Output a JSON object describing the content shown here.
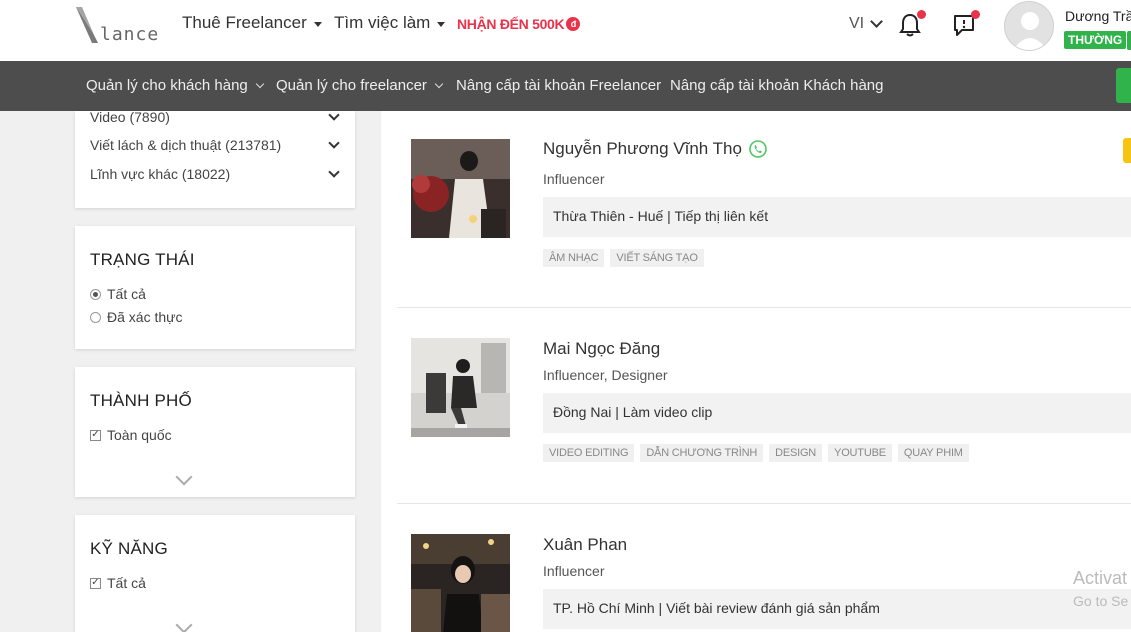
{
  "header": {
    "logo_text": "lance",
    "nav": [
      {
        "label": "Thuê Freelancer"
      },
      {
        "label": "Tìm việc làm"
      }
    ],
    "promo": "NHẬN ĐẾN 500K",
    "promo_badge": "đ",
    "lang": "VI",
    "user": {
      "name": "Dương Trầ",
      "level": "THƯỜNG"
    },
    "colors": {
      "promo": "#e8334a",
      "level": "#2fb34a",
      "notification_dot": "#e8334a"
    }
  },
  "subnav": {
    "items": [
      {
        "label": "Quản lý cho khách hàng"
      },
      {
        "label": "Quản lý cho freelancer"
      },
      {
        "label": "Nâng cấp tài khoản Freelancer"
      },
      {
        "label": "Nâng cấp tài khoản Khách hàng"
      }
    ]
  },
  "sidebar": {
    "categories": [
      {
        "label": "Video (7890)"
      },
      {
        "label": "Viết lách & dịch thuật (213781)"
      },
      {
        "label": "Lĩnh vực khác (18022)"
      }
    ],
    "status": {
      "title": "TRẠNG THÁI",
      "options": [
        {
          "label": "Tất cả",
          "selected": true
        },
        {
          "label": "Đã xác thực",
          "selected": false
        }
      ]
    },
    "city": {
      "title": "THÀNH PHỐ",
      "options": [
        {
          "label": "Toàn quốc",
          "checked": true
        }
      ]
    },
    "skills": {
      "title": "KỸ NĂNG",
      "options": [
        {
          "label": "Tất cả",
          "checked": true
        }
      ]
    }
  },
  "freelancers": [
    {
      "name": "Nguyễn Phương Vĩnh Thọ",
      "verified_icon": "whatsapp-icon",
      "role": "Influencer",
      "info": "Thừa Thiên - Huế | Tiếp thị liên kết",
      "tags": [
        "ÂM NHẠC",
        "VIẾT SÁNG TẠO"
      ]
    },
    {
      "name": "Mai Ngọc Đăng",
      "role": "Influencer, Designer",
      "info": "Đồng Nai | Làm video clip",
      "tags": [
        "VIDEO EDITING",
        "DẪN CHƯƠNG TRÌNH",
        "DESIGN",
        "YOUTUBE",
        "QUAY PHIM"
      ]
    },
    {
      "name": "Xuân Phan",
      "role": "Influencer",
      "info": "TP. Hồ Chí Minh | Viết bài review đánh giá sản phẩm",
      "tags": []
    }
  ],
  "watermark": {
    "line1": "Activat",
    "line2": "Go to Se"
  }
}
